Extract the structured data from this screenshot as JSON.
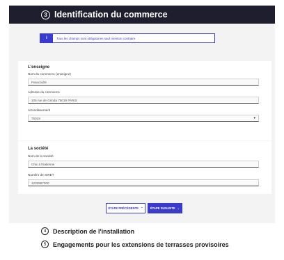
{
  "section_header": {
    "number": "3",
    "title": "Identification du commerce"
  },
  "info_banner": {
    "icon": "info-icon",
    "text": "Tous les champs sont obligatoires sauf mention contraire"
  },
  "enseigne": {
    "title": "L'enseigne",
    "nom": {
      "label": "Nom du commerce (enseigne)",
      "value": "Paracoulté"
    },
    "adresse": {
      "label": "Adresse du commerce",
      "value": "105 rue de Grinda 75019 PARIS"
    },
    "arrondissement": {
      "label": "Arrondissement",
      "value": "75019"
    }
  },
  "societe": {
    "title": "La société",
    "nom": {
      "label": "Nom de la société",
      "value": "Chic à l'italienne"
    },
    "siret": {
      "label": "Numéro de SIRET",
      "value": "1234567000"
    }
  },
  "buttons": {
    "prev": "ÉTAPE PRÉCÉDENTE",
    "next": "ÉTAPE SUIVANTE"
  },
  "next_steps": [
    {
      "number": "4",
      "title": "Description de l'installation"
    },
    {
      "number": "5",
      "title": "Engagements pour les extensions de terrasses provisoires"
    }
  ],
  "colors": {
    "header_bg": "#1e1e2e",
    "accent": "#3a3acb",
    "page_bg": "#f3f3f3"
  }
}
